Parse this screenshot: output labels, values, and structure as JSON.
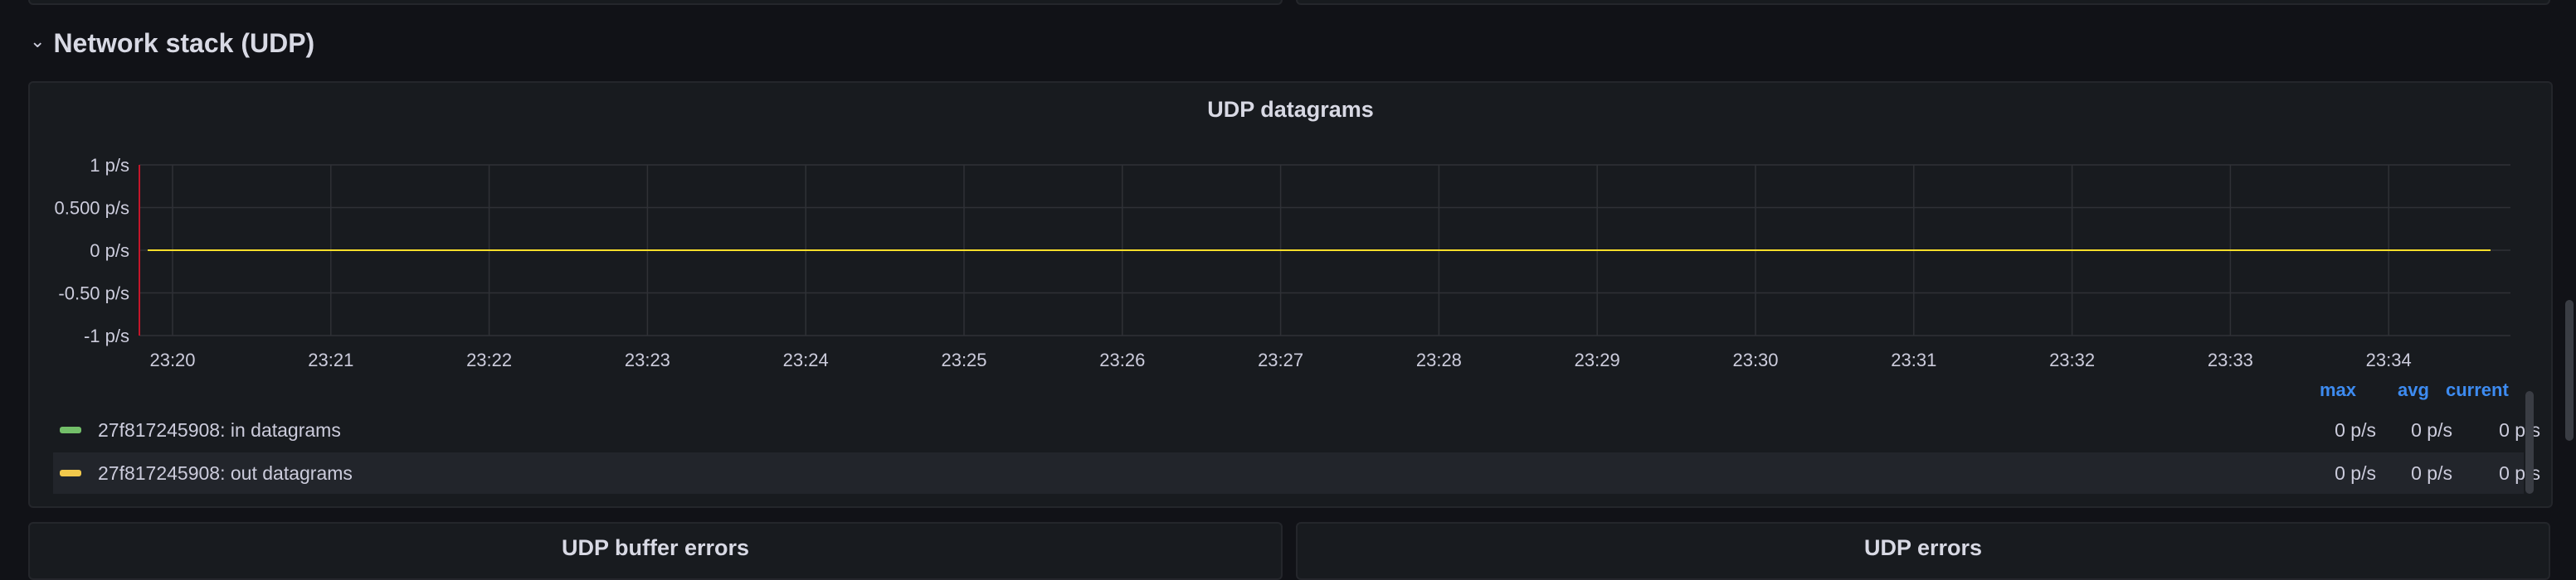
{
  "row": {
    "title": "Network stack (UDP)",
    "chevron_icon": "chevron-down-icon"
  },
  "panel": {
    "title": "UDP datagrams"
  },
  "chart_data": {
    "type": "line",
    "title": "UDP datagrams",
    "y_ticks": [
      "1 p/s",
      "0.500 p/s",
      "0 p/s",
      "-0.50 p/s",
      "-1 p/s"
    ],
    "ylim": [
      -1,
      1
    ],
    "x_ticks": [
      "23:20",
      "23:21",
      "23:22",
      "23:23",
      "23:24",
      "23:25",
      "23:26",
      "23:27",
      "23:28",
      "23:29",
      "23:30",
      "23:31",
      "23:32",
      "23:33",
      "23:34"
    ],
    "grid": true,
    "series": [
      {
        "name": "27f817245908: in datagrams",
        "color": "#73bf69",
        "x": [
          "23:20",
          "23:34"
        ],
        "values": [
          0,
          0
        ]
      },
      {
        "name": "27f817245908: out datagrams",
        "color": "#fade2a",
        "x": [
          "23:20",
          "23:34"
        ],
        "values": [
          0,
          0
        ]
      }
    ]
  },
  "legend": {
    "headers": {
      "max": "max",
      "avg": "avg",
      "current": "current"
    },
    "rows": [
      {
        "label": "27f817245908: in datagrams",
        "color": "#73bf69",
        "max": "0 p/s",
        "avg": "0 p/s",
        "current": "0 p/s"
      },
      {
        "label": "27f817245908: out datagrams",
        "color": "#f2c94c",
        "max": "0 p/s",
        "avg": "0 p/s",
        "current": "0 p/s"
      }
    ]
  },
  "bottom_panels": [
    {
      "title": "UDP buffer errors"
    },
    {
      "title": "UDP errors"
    }
  ]
}
